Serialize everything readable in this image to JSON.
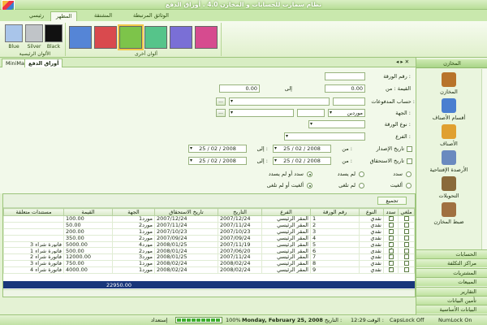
{
  "window": {
    "title": "نظام سمارت للحسابات و المخازن 4.0 . أوراق الدفع"
  },
  "ribbon": {
    "tabs": [
      "رئيسي",
      "المظهر",
      "المشتقة",
      "الوثائق المرتبطة"
    ],
    "active_tab": 1,
    "main_colors_label": "الألوان الرئيسية",
    "other_colors_label": "ألوان أخرى",
    "main_colors": [
      {
        "name": "Black",
        "color": "#111111"
      },
      {
        "name": "Silver",
        "color": "#c0c4c8"
      },
      {
        "name": "Blue",
        "color": "#a9c5ea"
      }
    ],
    "other_colors": [
      "#d64b8f",
      "#7a6fd6",
      "#56c48a",
      "#7dc44a",
      "#d94a4e",
      "#5585d6"
    ]
  },
  "doc_tabs": {
    "active": "أوراق الدفع",
    "other": "MiniMax"
  },
  "sidebar": {
    "header": "المخازن",
    "items": [
      {
        "label": "المخازن",
        "color": "#b8742a"
      },
      {
        "label": "أقسام الأصناف",
        "color": "#4a7fd0"
      },
      {
        "label": "الأصناف",
        "color": "#e0a030"
      },
      {
        "label": "الأرصدة الإفتتاحية",
        "color": "#6a8abf"
      },
      {
        "label": "التحويلات",
        "color": "#8a6a3a"
      },
      {
        "label": "ضبط المخازن",
        "color": "#a07040"
      }
    ],
    "categories": [
      "الحسابات",
      "مراكز التكلفة",
      "المشتريات",
      "المبيعات",
      "التقارير",
      "تأمين البيانات",
      "البيانات الأساسية"
    ]
  },
  "form": {
    "paper_no_label": "رقم الورقة :",
    "value_from_label": "القيمة :  من",
    "to_label": "إلى",
    "value_from": "0.00",
    "value_to": "0.00",
    "payment_account_label": "حساب المدفوعات :",
    "party_label": "الجهة :",
    "party_value": "موردين",
    "paper_type_label": "نوع الورقة :",
    "branch_label": "الفرع :",
    "issue_date_label": "تاريخ الإصدار",
    "due_date_label": "تاريخ الاستحقاق",
    "from_label": "من :",
    "to_label2": "إلى :",
    "dates": {
      "issue_from": "25 / 02 / 2008",
      "issue_to": "25 / 02 / 2008",
      "due_from": "25 / 02 / 2008",
      "due_to": "25 / 02 / 2008"
    },
    "radios": {
      "paid": "سدد",
      "not_paid": "لم يسدد",
      "paid_or_not": "سدد أو لم يسدد",
      "canceled": "ألغيت",
      "not_received": "لم تلغى",
      "canceled_or_not": "ألغيت أو لم تلغى"
    },
    "ellipsis": "..."
  },
  "grid": {
    "group_label": "تجميع",
    "columns": [
      "ملغي",
      "سدد",
      "النوع",
      "رقم الورقة",
      "الفرع",
      "التاريخ",
      "تاريخ الاستحقاق",
      "الجهة",
      "القيمة",
      "مستندات متعلقة"
    ],
    "rows": [
      {
        "canceled": false,
        "paid": true,
        "type": "نقدي",
        "no": "1",
        "branch": "المقر الرئيسي",
        "date": "2007/12/24",
        "due": "2007/12/24",
        "party": "مورد1",
        "value": "100.00",
        "docs": ""
      },
      {
        "canceled": false,
        "paid": true,
        "type": "نقدي",
        "no": "2",
        "branch": "المقر الرئيسي",
        "date": "2007/11/24",
        "due": "2007/11/24",
        "party": "مورد2",
        "value": "50.00",
        "docs": ""
      },
      {
        "canceled": false,
        "paid": true,
        "type": "نقدي",
        "no": "3",
        "branch": "المقر الرئيسي",
        "date": "2007/10/23",
        "due": "2007/10/23",
        "party": "مورد1",
        "value": "200.00",
        "docs": ""
      },
      {
        "canceled": false,
        "paid": true,
        "type": "نقدي",
        "no": "4",
        "branch": "المقر الرئيسي",
        "date": "2007/09/24",
        "due": "2007/09/24",
        "party": "مورد2",
        "value": "350.00",
        "docs": ""
      },
      {
        "canceled": false,
        "paid": true,
        "type": "نقدي",
        "no": "5",
        "branch": "المقر الرئيسي",
        "date": "2007/11/19",
        "due": "2008/01/25",
        "party": "مورد4",
        "value": "5000.00",
        "docs": "فاتورة شراء 3"
      },
      {
        "canceled": false,
        "paid": true,
        "type": "نقدي",
        "no": "6",
        "branch": "المقر الرئيسي",
        "date": "2007/06/20",
        "due": "2008/01/24",
        "party": "مورد2",
        "value": "500.00",
        "docs": "فاتورة شراء 1"
      },
      {
        "canceled": false,
        "paid": true,
        "type": "نقدي",
        "no": "7",
        "branch": "المقر الرئيسي",
        "date": "2007/11/24",
        "due": "2008/01/25",
        "party": "مورد3",
        "value": "12000.00",
        "docs": "فاتورة شراء 2"
      },
      {
        "canceled": false,
        "paid": true,
        "type": "نقدي",
        "no": "8",
        "branch": "المقر الرئيسي",
        "date": "2008/02/24",
        "due": "2008/02/24",
        "party": "مورد1",
        "value": "750.00",
        "docs": "فاتورة شراء 3"
      },
      {
        "canceled": false,
        "paid": true,
        "type": "نقدي",
        "no": "9",
        "branch": "المقر الرئيسي",
        "date": "2008/02/24",
        "due": "2008/02/24",
        "party": "مورد1",
        "value": "4000.00",
        "docs": "فاتورة شراء 4"
      }
    ],
    "total": "22950.00"
  },
  "status": {
    "numlock": "NumLock On",
    "capslock": "CapsLock Off",
    "time_label": "الوقت :",
    "time": "12:29",
    "date_label": "التاريخ :",
    "date": "Monday, February 25, 2008",
    "zoom": "100%",
    "ready": "إستعداد",
    "progress": 1.0
  }
}
